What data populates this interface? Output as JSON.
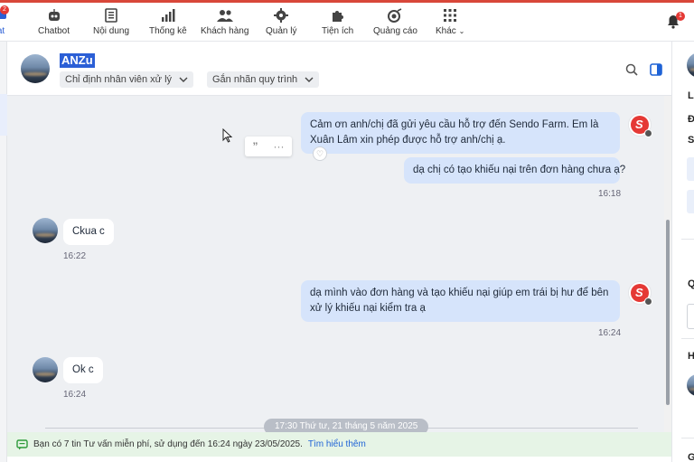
{
  "topnav": {
    "partial_first_label": "at",
    "partial_first_badge": "2",
    "items": [
      {
        "label": "Chatbot"
      },
      {
        "label": "Nội dung"
      },
      {
        "label": "Thống kê"
      },
      {
        "label": "Khách hàng"
      },
      {
        "label": "Quản lý"
      },
      {
        "label": "Tiện ích"
      },
      {
        "label": "Quảng cáo"
      },
      {
        "label": "Khác"
      }
    ],
    "notification_count": "1"
  },
  "conversation": {
    "contact_name": "ANZu",
    "assign_label": "Chỉ định nhân viên xử lý",
    "tag_label": "Gắn nhãn quy trình"
  },
  "messages": [
    {
      "dir": "out",
      "text": "Cảm ơn anh/chị đã gửi yêu cầu hỗ trợ đến Sendo Farm. Em là Xuân Lâm xin phép được hỗ trợ anh/chị ạ."
    },
    {
      "dir": "out",
      "text": "dạ chị có tạo khiếu nại trên đơn hàng chưa ạ?",
      "time": "16:18"
    },
    {
      "dir": "in",
      "text": "Ckua c",
      "time": "16:22"
    },
    {
      "dir": "out",
      "text": "dạ mình vào đơn hàng và tạo khiếu nại giúp em trái bị hư để bên xử lý khiếu nại kiểm tra ạ",
      "time": "16:24"
    },
    {
      "dir": "in",
      "text": "Ok c",
      "time": "16:24"
    }
  ],
  "date_separator": "17:30 Thứ tư, 21 tháng 5 năm 2025",
  "notice": {
    "text": "Bạn có 7 tin Tư vấn miễn phí, sử dụng đến 16:24 ngày 23/05/2025.",
    "link": "Tìm hiểu thêm"
  },
  "right_panel": {
    "letters": [
      "Li",
      "Đ",
      "Sc",
      "Q",
      "H",
      "G"
    ]
  },
  "colors": {
    "accent": "#d8473a",
    "outgoing_bubble": "#d6e4fb",
    "selection": "#2b5fd6",
    "notice_bg": "#e6f4e6"
  }
}
